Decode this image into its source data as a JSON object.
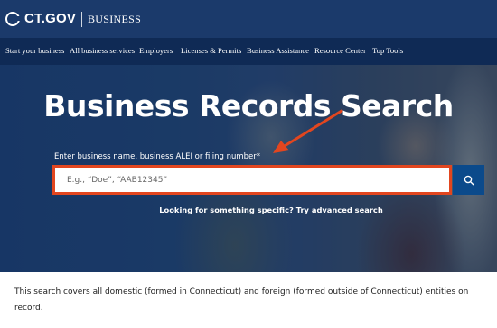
{
  "header": {
    "logo_text": "CT.GOV",
    "section_label": "BUSINESS"
  },
  "nav": {
    "items": [
      "Start your business",
      "All business services",
      "Employers",
      "Licenses & Permits",
      "Business Assistance",
      "Resource Center",
      "Top Tools"
    ]
  },
  "hero": {
    "title": "Business Records Search",
    "search_label": "Enter business name, business ALEI or filing number*",
    "search_placeholder": "E.g., “Doe”, “AAB12345”",
    "search_value": "",
    "specific_prefix": "Looking for something specific? Try ",
    "advanced_link": "advanced search"
  },
  "body": {
    "description": "This search covers all domestic (formed in Connecticut) and foreign (formed outside of Connecticut) entities on record."
  },
  "colors": {
    "header_bg": "#1b3a6b",
    "nav_bg": "#0f2a55",
    "highlight": "#e2461f",
    "search_button": "#0b4a8b"
  },
  "icons": {
    "logo": "ct-logo-icon",
    "search": "search-icon",
    "annotation": "arrow-annotation-icon"
  }
}
